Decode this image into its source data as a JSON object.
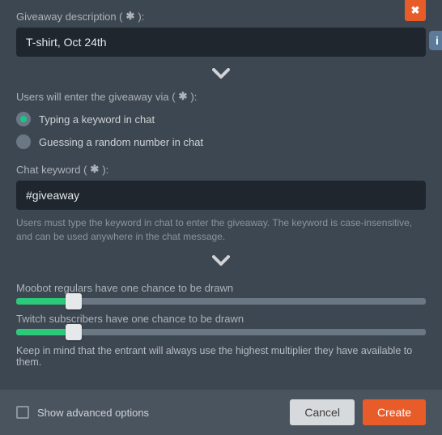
{
  "close_icon": "✖",
  "info_icon": "i",
  "description": {
    "label": "Giveaway description (",
    "req": "✱",
    "label_end": "):",
    "value": "T-shirt, Oct 24th"
  },
  "entry": {
    "label": "Users will enter the giveaway via (",
    "req": "✱",
    "label_end": "):",
    "options": [
      {
        "label": "Typing a keyword in chat",
        "selected": true
      },
      {
        "label": "Guessing a random number in chat",
        "selected": false
      }
    ]
  },
  "keyword": {
    "label": "Chat keyword (",
    "req": "✱",
    "label_end": "):",
    "value": "#giveaway",
    "help": "Users must type the keyword in chat to enter the giveaway. The keyword is case-insensitive, and can be used anywhere in the chat message."
  },
  "sliders": [
    {
      "label": "Moobot regulars have one chance to be drawn",
      "percent": 14
    },
    {
      "label": "Twitch subscribers have one chance to be drawn",
      "percent": 14
    }
  ],
  "multiplier_note": "Keep in mind that the entrant will always use the highest multiplier they have available to them.",
  "footer": {
    "advanced": "Show advanced options",
    "cancel": "Cancel",
    "create": "Create"
  }
}
